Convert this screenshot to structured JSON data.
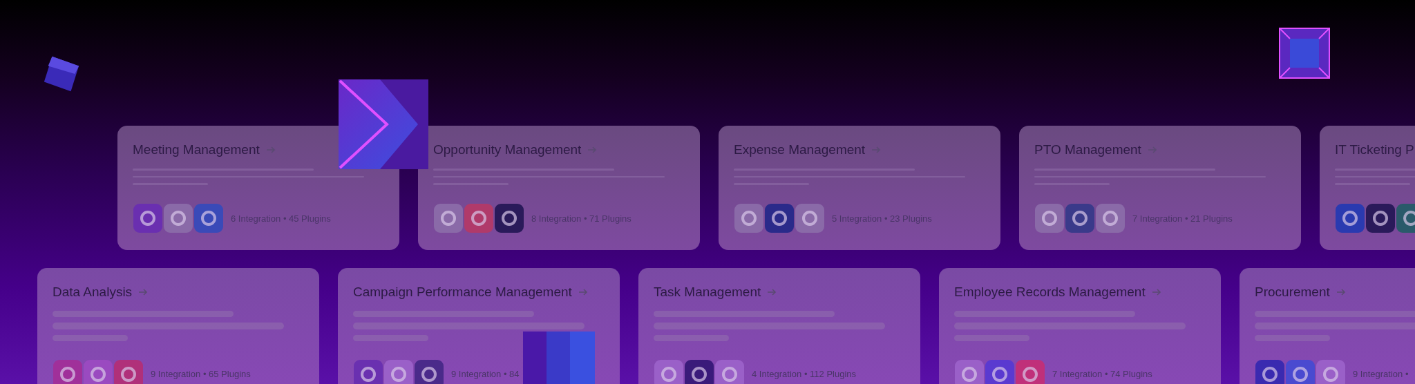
{
  "rows": [
    {
      "cards": [
        {
          "title": "Meeting Management",
          "summary": "6 Integration • 45 Plugins",
          "logos": [
            {
              "color": "#6a2fb0"
            },
            {
              "color": "#8a6aa8"
            },
            {
              "color": "#3a4ab8"
            }
          ]
        },
        {
          "title": "Opportunity Management",
          "summary": "8 Integration • 71 Plugins",
          "logos": [
            {
              "color": "#8a6aa8"
            },
            {
              "color": "#b03a6a"
            },
            {
              "color": "#2a1a5a"
            }
          ]
        },
        {
          "title": "Expense Management",
          "summary": "5 Integration • 23 Plugins",
          "logos": [
            {
              "color": "#8a6aa8"
            },
            {
              "color": "#2a2a8a"
            },
            {
              "color": "#8a6aa8"
            }
          ]
        },
        {
          "title": "PTO Management",
          "summary": "7 Integration • 21 Plugins",
          "logos": [
            {
              "color": "#8a6aa8"
            },
            {
              "color": "#3a3a8a"
            },
            {
              "color": "#8a6aa8"
            }
          ]
        },
        {
          "title": "IT Ticketing P",
          "logos": [
            {
              "color": "#2a3ab0"
            },
            {
              "color": "#2a1a5a"
            },
            {
              "color": "#2a5a6a"
            }
          ]
        }
      ]
    },
    {
      "cards": [
        {
          "title": "Data Analysis",
          "summary": "9 Integration • 65 Plugins",
          "logos": [
            {
              "color": "#a0309a"
            },
            {
              "color": "#9a4ac0"
            },
            {
              "color": "#b0307a"
            }
          ]
        },
        {
          "title": "Campaign Performance Management",
          "summary": "9 Integration • 84",
          "logos": [
            {
              "color": "#6a30b0"
            },
            {
              "color": "#9a60c8"
            },
            {
              "color": "#4a2a8a"
            }
          ]
        },
        {
          "title": "Task Management",
          "summary": "4 Integration • 112 Plugins",
          "logos": [
            {
              "color": "#9a60c8"
            },
            {
              "color": "#3a1a7a"
            },
            {
              "color": "#9a60c8"
            }
          ]
        },
        {
          "title": "Employee Records Management",
          "summary": "7 Integration • 74 Plugins",
          "logos": [
            {
              "color": "#9a60c8"
            },
            {
              "color": "#5a3ad0"
            },
            {
              "color": "#c0307a"
            }
          ]
        },
        {
          "title": "Procurement",
          "summary": "9 Integration •",
          "logos": [
            {
              "color": "#3a2ab0"
            },
            {
              "color": "#4a4ad0"
            },
            {
              "color": "#9a60c8"
            }
          ]
        }
      ]
    }
  ]
}
